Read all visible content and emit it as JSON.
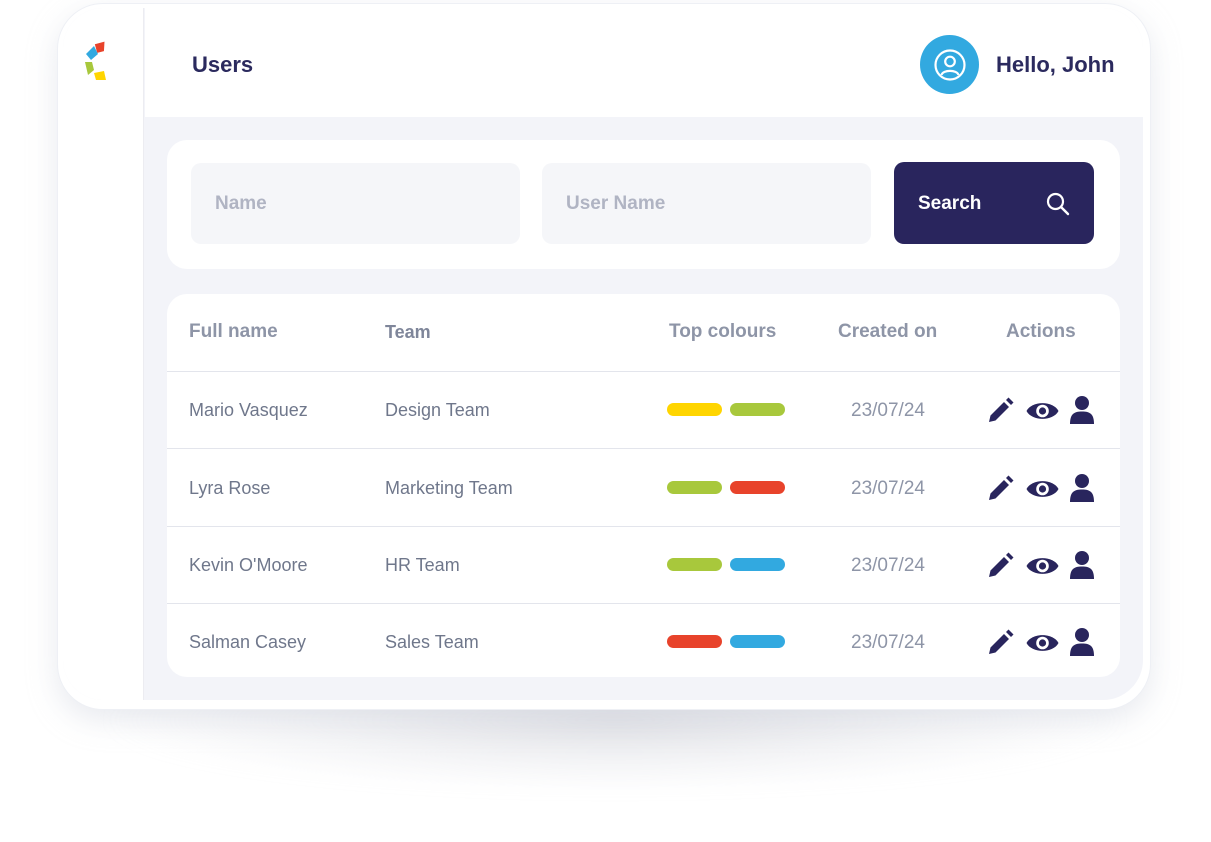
{
  "header": {
    "title": "Users",
    "greeting": "Hello, John"
  },
  "search": {
    "name_placeholder": "Name",
    "username_placeholder": "User Name",
    "button_label": "Search"
  },
  "table": {
    "columns": [
      "Full name",
      "Team",
      "Top colours",
      "Created on",
      "Actions"
    ],
    "rows": [
      {
        "full_name": "Mario Vasquez",
        "team": "Design Team",
        "colours": [
          "#ffd500",
          "#a8c83c"
        ],
        "created_on": "23/07/24"
      },
      {
        "full_name": "Lyra Rose",
        "team": "Marketing Team",
        "colours": [
          "#a8c83c",
          "#e8432b"
        ],
        "created_on": "23/07/24"
      },
      {
        "full_name": "Kevin O'Moore",
        "team": "HR Team",
        "colours": [
          "#a8c83c",
          "#32a9e0"
        ],
        "created_on": "23/07/24"
      },
      {
        "full_name": "Salman Casey",
        "team": "Sales Team",
        "colours": [
          "#e8432b",
          "#32a9e0"
        ],
        "created_on": "23/07/24"
      }
    ],
    "action_icons": [
      "pencil-icon",
      "eye-icon",
      "user-icon"
    ]
  },
  "colors": {
    "primary": "#29255d",
    "accent": "#32a9e0",
    "background": "#f3f4f9"
  }
}
